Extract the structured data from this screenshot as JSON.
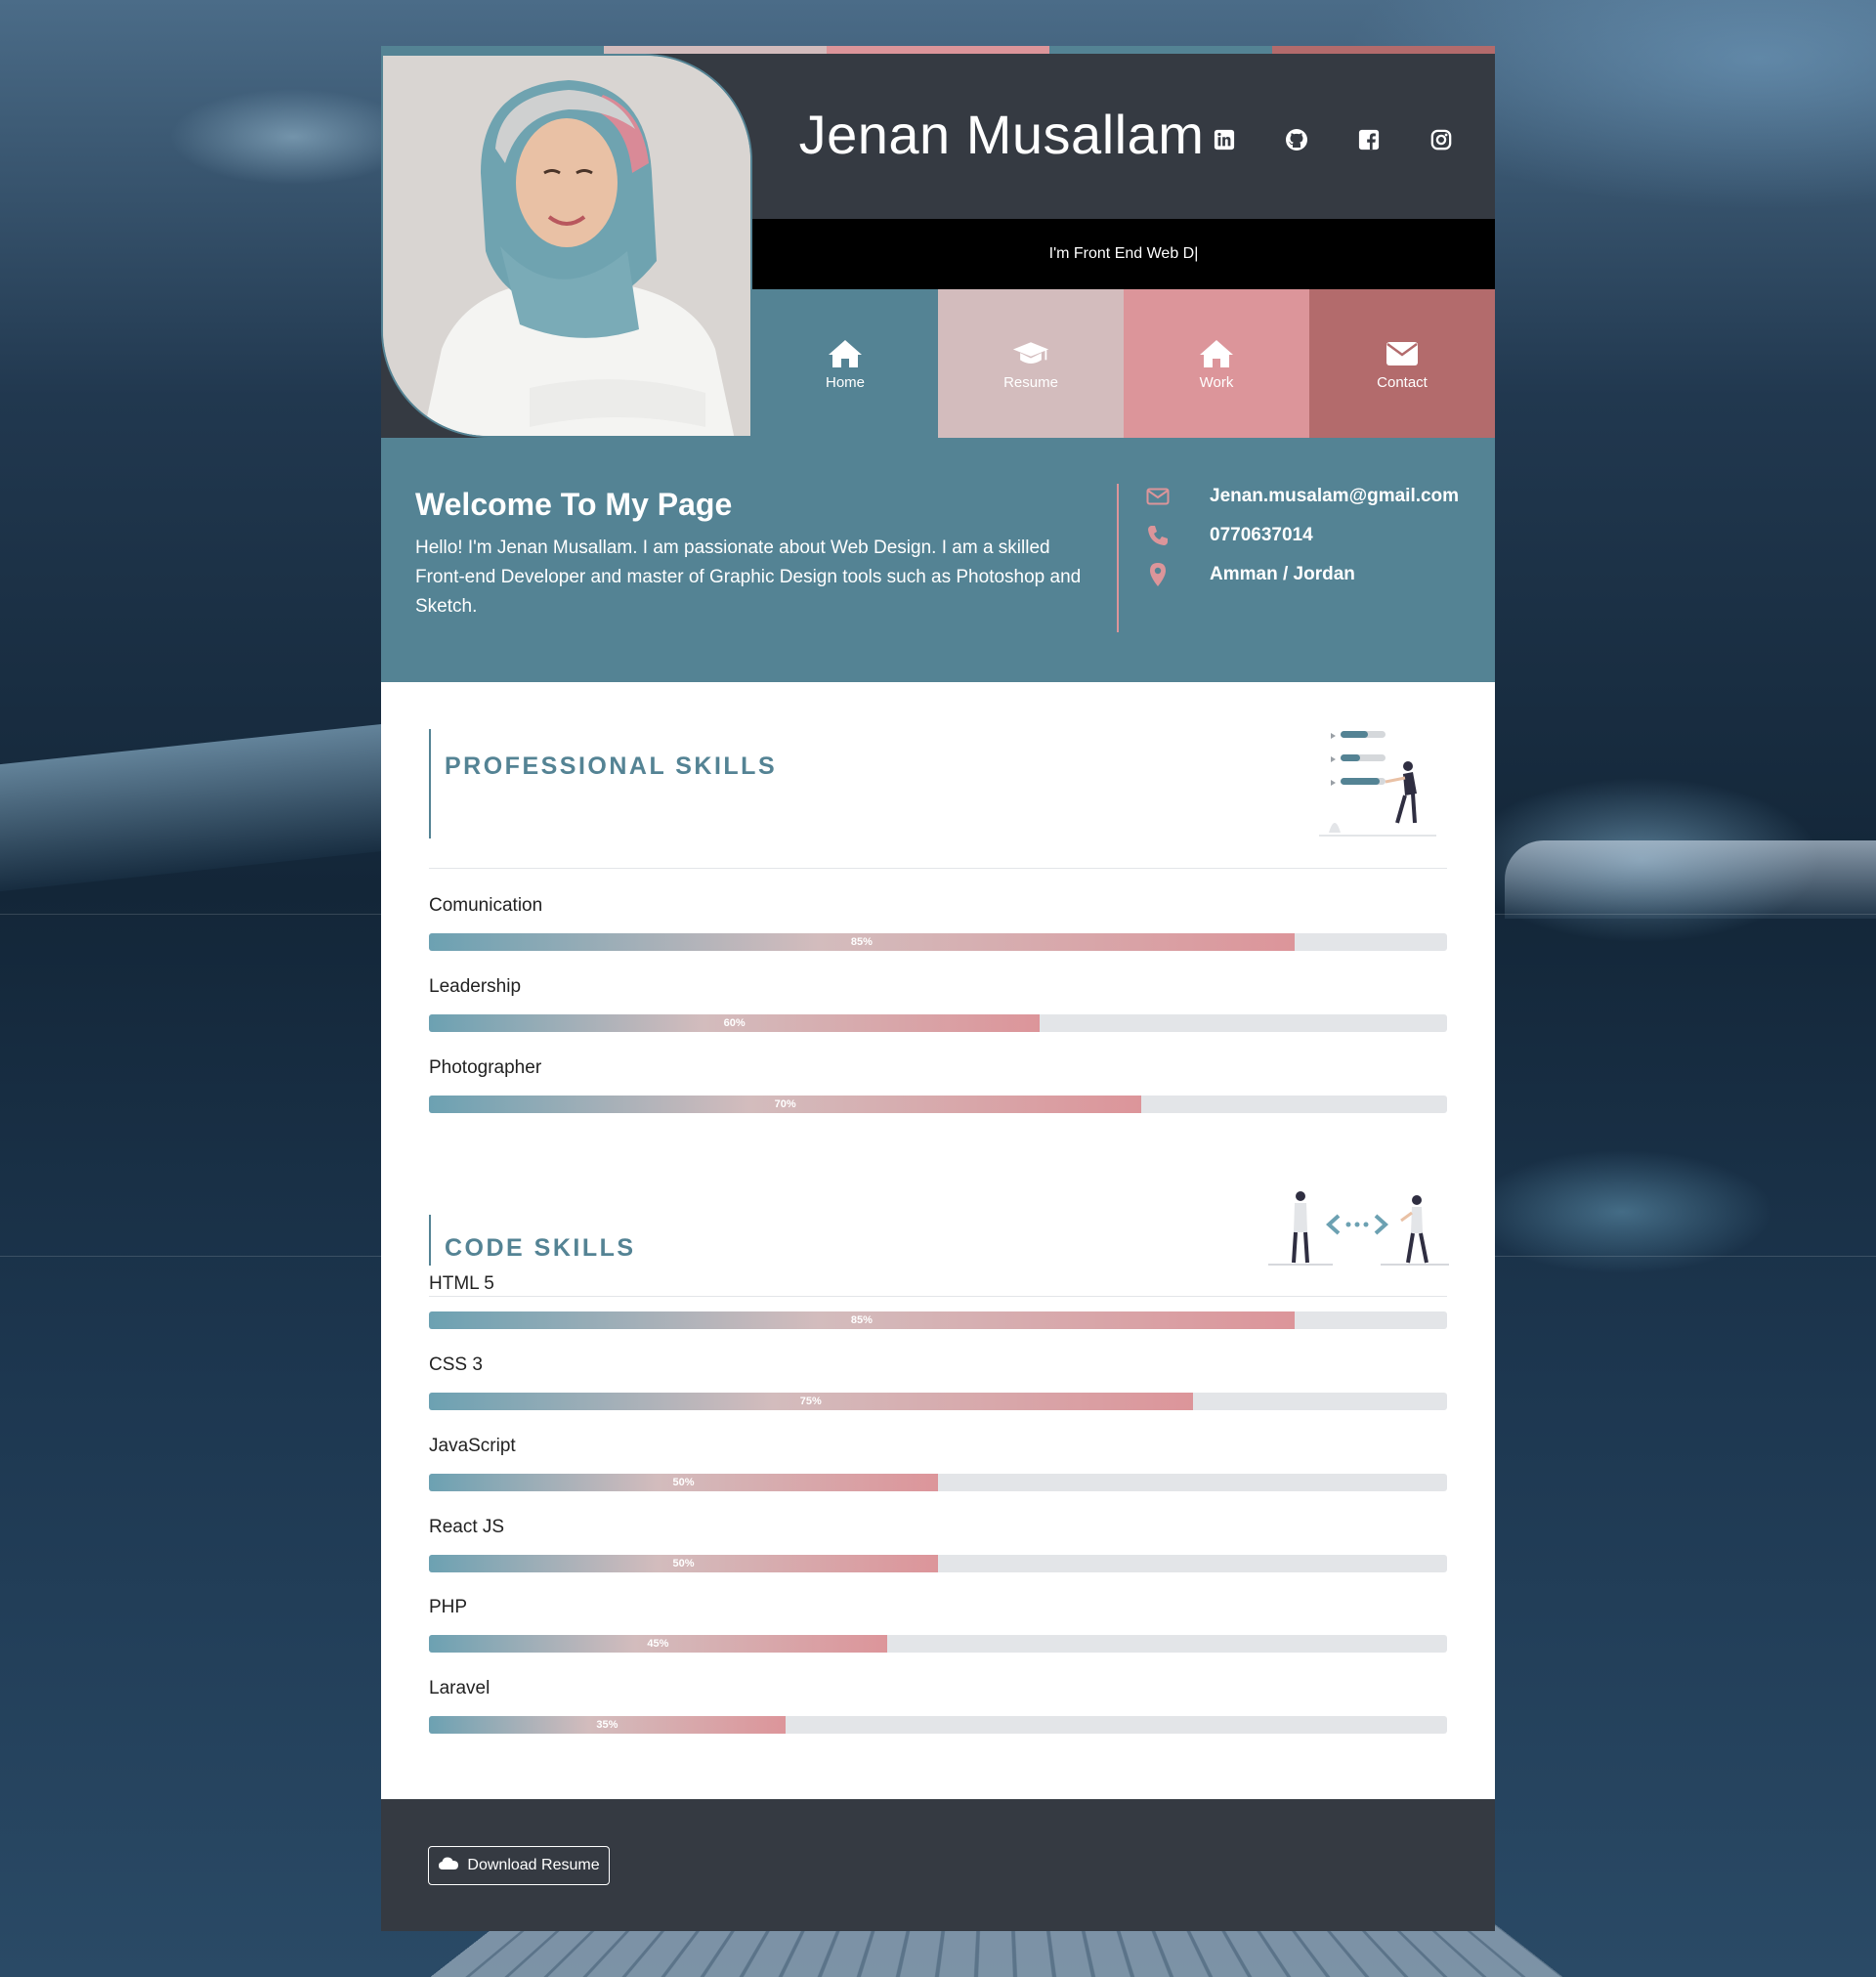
{
  "profile": {
    "name": "Jenan Musallam",
    "typing_text": "I'm Front End Web D|"
  },
  "colors": {
    "teal": "#548394",
    "blush": "#d3bcbd",
    "pink": "#dc959a",
    "rose": "#b36b6c",
    "dark": "#353a42",
    "black": "#000000"
  },
  "social": [
    {
      "icon": "linkedin-icon"
    },
    {
      "icon": "github-icon"
    },
    {
      "icon": "facebook-icon"
    },
    {
      "icon": "instagram-icon"
    }
  ],
  "nav": [
    {
      "label": "Home",
      "icon": "home-icon"
    },
    {
      "label": "Resume",
      "icon": "graduation-cap-icon"
    },
    {
      "label": "Work",
      "icon": "home-icon"
    },
    {
      "label": "Contact",
      "icon": "envelope-icon"
    }
  ],
  "welcome": {
    "title": "Welcome To My Page",
    "text": "Hello! I'm Jenan Musallam. I am passionate about Web Design. I am a skilled Front-end Developer and master of Graphic Design tools such as Photoshop and Sketch."
  },
  "contact": {
    "email": "Jenan.musalam@gmail.com",
    "phone": "0770637014",
    "location": "Amman / Jordan"
  },
  "professional": {
    "title": "PROFESSIONAL SKILLS",
    "items": [
      {
        "name": "Comunication",
        "percent": 85,
        "label": "85%"
      },
      {
        "name": "Leadership",
        "percent": 60,
        "label": "60%"
      },
      {
        "name": "Photographer",
        "percent": 70,
        "label": "70%"
      }
    ]
  },
  "code": {
    "title": "CODE SKILLS",
    "items": [
      {
        "name": "HTML 5",
        "percent": 85,
        "label": "85%"
      },
      {
        "name": "CSS 3",
        "percent": 75,
        "label": "75%"
      },
      {
        "name": "JavaScript",
        "percent": 50,
        "label": "50%"
      },
      {
        "name": "React JS",
        "percent": 50,
        "label": "50%"
      },
      {
        "name": "PHP",
        "percent": 45,
        "label": "45%"
      },
      {
        "name": "Laravel",
        "percent": 35,
        "label": "35%"
      }
    ]
  },
  "footer": {
    "download_label": "Download Resume"
  }
}
